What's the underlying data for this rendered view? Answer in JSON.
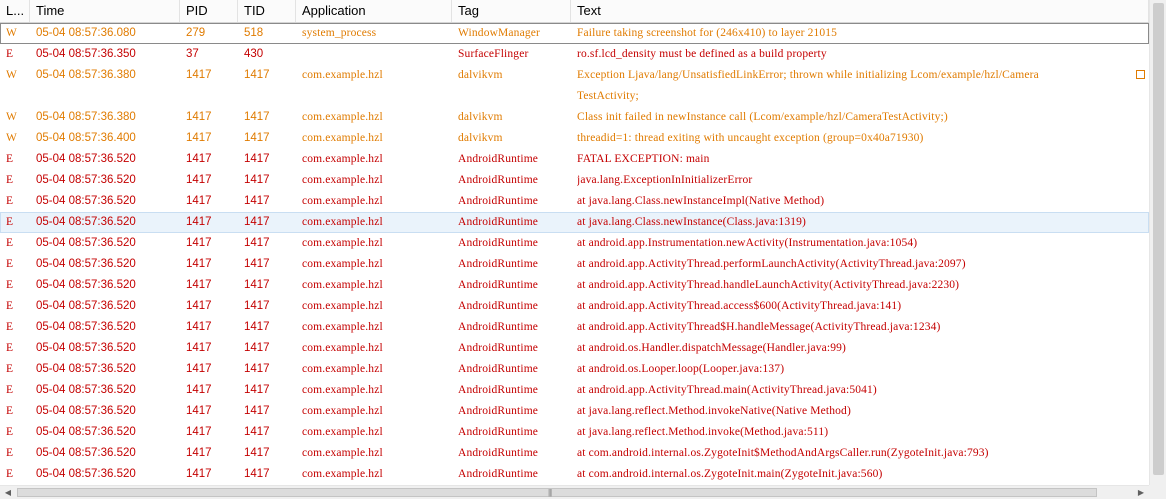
{
  "columns": {
    "level": "L...",
    "time": "Time",
    "pid": "PID",
    "tid": "TID",
    "application": "Application",
    "tag": "Tag",
    "text": "Text"
  },
  "colors": {
    "warn": "#e07b00",
    "error": "#c40000",
    "hover_row": "#eaf3fb"
  },
  "icons": {
    "scroll_left": "scroll-left-icon",
    "scroll_right": "scroll-right-icon",
    "grip": "scroll-grip-icon"
  },
  "scrollbars": {
    "grip_glyph": "|||",
    "left_arrow": "◀",
    "right_arrow": "▶"
  },
  "rows": [
    {
      "level": "W",
      "time": "05-04 08:57:36.080",
      "pid": "279",
      "tid": "518",
      "app": "system_process",
      "tag": "WindowManager",
      "text": "Failure taking screenshot for (246x410) to layer 21015",
      "selected": true
    },
    {
      "level": "E",
      "time": "05-04 08:57:36.350",
      "pid": "37",
      "tid": "430",
      "app": "",
      "tag": "SurfaceFlinger",
      "text": "ro.sf.lcd_density must be defined as a build property"
    },
    {
      "level": "W",
      "time": "05-04 08:57:36.380",
      "pid": "1417",
      "tid": "1417",
      "app": "com.example.hzl",
      "tag": "dalvikvm",
      "text": "Exception Ljava/lang/UnsatisfiedLinkError; thrown while initializing Lcom/example/hzl/Camera",
      "wrapped": true
    },
    {
      "level": "",
      "time": "",
      "pid": "",
      "tid": "",
      "app": "",
      "tag": "",
      "text": "TestActivity;",
      "continuation": true
    },
    {
      "level": "W",
      "time": "05-04 08:57:36.380",
      "pid": "1417",
      "tid": "1417",
      "app": "com.example.hzl",
      "tag": "dalvikvm",
      "text": "Class init failed in newInstance call (Lcom/example/hzl/CameraTestActivity;)"
    },
    {
      "level": "W",
      "time": "05-04 08:57:36.400",
      "pid": "1417",
      "tid": "1417",
      "app": "com.example.hzl",
      "tag": "dalvikvm",
      "text": "threadid=1: thread exiting with uncaught exception (group=0x40a71930)"
    },
    {
      "level": "E",
      "time": "05-04 08:57:36.520",
      "pid": "1417",
      "tid": "1417",
      "app": "com.example.hzl",
      "tag": "AndroidRuntime",
      "text": "FATAL EXCEPTION: main"
    },
    {
      "level": "E",
      "time": "05-04 08:57:36.520",
      "pid": "1417",
      "tid": "1417",
      "app": "com.example.hzl",
      "tag": "AndroidRuntime",
      "text": "java.lang.ExceptionInInitializerError"
    },
    {
      "level": "E",
      "time": "05-04 08:57:36.520",
      "pid": "1417",
      "tid": "1417",
      "app": "com.example.hzl",
      "tag": "AndroidRuntime",
      "text": "at java.lang.Class.newInstanceImpl(Native Method)"
    },
    {
      "level": "E",
      "time": "05-04 08:57:36.520",
      "pid": "1417",
      "tid": "1417",
      "app": "com.example.hzl",
      "tag": "AndroidRuntime",
      "text": "at java.lang.Class.newInstance(Class.java:1319)",
      "hover": true
    },
    {
      "level": "E",
      "time": "05-04 08:57:36.520",
      "pid": "1417",
      "tid": "1417",
      "app": "com.example.hzl",
      "tag": "AndroidRuntime",
      "text": "at android.app.Instrumentation.newActivity(Instrumentation.java:1054)"
    },
    {
      "level": "E",
      "time": "05-04 08:57:36.520",
      "pid": "1417",
      "tid": "1417",
      "app": "com.example.hzl",
      "tag": "AndroidRuntime",
      "text": "at android.app.ActivityThread.performLaunchActivity(ActivityThread.java:2097)"
    },
    {
      "level": "E",
      "time": "05-04 08:57:36.520",
      "pid": "1417",
      "tid": "1417",
      "app": "com.example.hzl",
      "tag": "AndroidRuntime",
      "text": "at android.app.ActivityThread.handleLaunchActivity(ActivityThread.java:2230)"
    },
    {
      "level": "E",
      "time": "05-04 08:57:36.520",
      "pid": "1417",
      "tid": "1417",
      "app": "com.example.hzl",
      "tag": "AndroidRuntime",
      "text": "at android.app.ActivityThread.access$600(ActivityThread.java:141)"
    },
    {
      "level": "E",
      "time": "05-04 08:57:36.520",
      "pid": "1417",
      "tid": "1417",
      "app": "com.example.hzl",
      "tag": "AndroidRuntime",
      "text": "at android.app.ActivityThread$H.handleMessage(ActivityThread.java:1234)"
    },
    {
      "level": "E",
      "time": "05-04 08:57:36.520",
      "pid": "1417",
      "tid": "1417",
      "app": "com.example.hzl",
      "tag": "AndroidRuntime",
      "text": "at android.os.Handler.dispatchMessage(Handler.java:99)"
    },
    {
      "level": "E",
      "time": "05-04 08:57:36.520",
      "pid": "1417",
      "tid": "1417",
      "app": "com.example.hzl",
      "tag": "AndroidRuntime",
      "text": "at android.os.Looper.loop(Looper.java:137)"
    },
    {
      "level": "E",
      "time": "05-04 08:57:36.520",
      "pid": "1417",
      "tid": "1417",
      "app": "com.example.hzl",
      "tag": "AndroidRuntime",
      "text": "at android.app.ActivityThread.main(ActivityThread.java:5041)"
    },
    {
      "level": "E",
      "time": "05-04 08:57:36.520",
      "pid": "1417",
      "tid": "1417",
      "app": "com.example.hzl",
      "tag": "AndroidRuntime",
      "text": "at java.lang.reflect.Method.invokeNative(Native Method)"
    },
    {
      "level": "E",
      "time": "05-04 08:57:36.520",
      "pid": "1417",
      "tid": "1417",
      "app": "com.example.hzl",
      "tag": "AndroidRuntime",
      "text": "at java.lang.reflect.Method.invoke(Method.java:511)"
    },
    {
      "level": "E",
      "time": "05-04 08:57:36.520",
      "pid": "1417",
      "tid": "1417",
      "app": "com.example.hzl",
      "tag": "AndroidRuntime",
      "text": "at com.android.internal.os.ZygoteInit$MethodAndArgsCaller.run(ZygoteInit.java:793)"
    },
    {
      "level": "E",
      "time": "05-04 08:57:36.520",
      "pid": "1417",
      "tid": "1417",
      "app": "com.example.hzl",
      "tag": "AndroidRuntime",
      "text": "at com.android.internal.os.ZygoteInit.main(ZygoteInit.java:560)"
    }
  ]
}
